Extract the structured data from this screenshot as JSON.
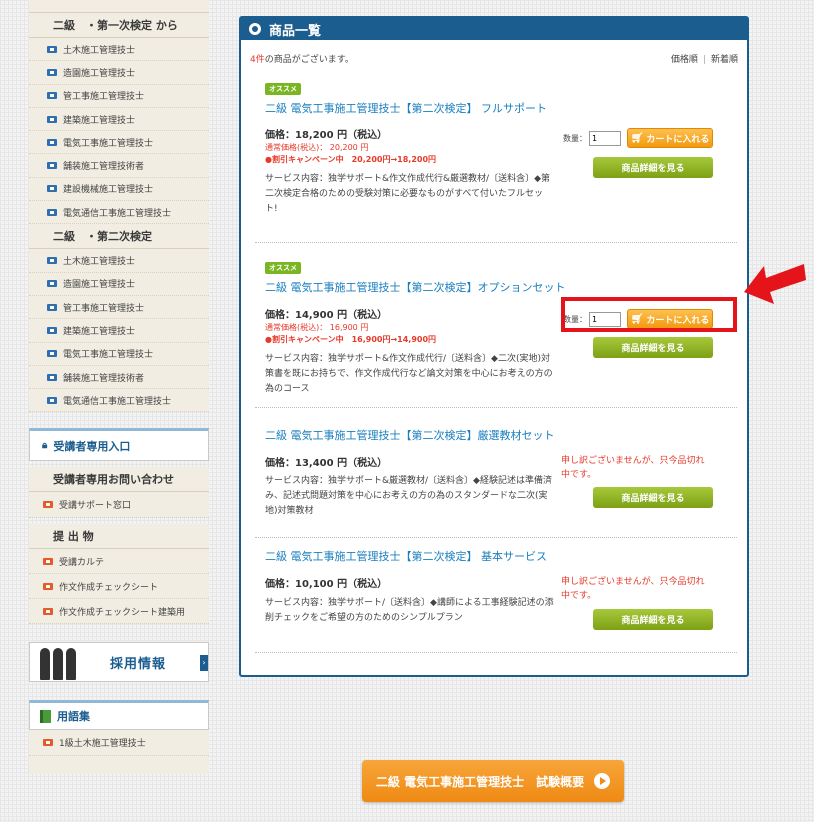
{
  "sidebar": {
    "section1_title": "二級　・第一次検定 から",
    "section1_items": [
      "土木施工管理技士",
      "造園施工管理技士",
      "管工事施工管理技士",
      "建築施工管理技士",
      "電気工事施工管理技士",
      "舗装施工管理技術者",
      "建設機械施工管理技士",
      "電気通信工事施工管理技士"
    ],
    "section2_title": "二級　・第二次検定",
    "section2_items": [
      "土木施工管理技士",
      "造園施工管理技士",
      "管工事施工管理技士",
      "建築施工管理技士",
      "電気工事施工管理技士",
      "舗装施工管理技術者",
      "電気通信工事施工管理技士"
    ],
    "member_entry": "受講者専用入口",
    "contact_title": "受講者専用お問い合わせ",
    "contact_items": [
      "受講サポート窓口"
    ],
    "submission_title": "提 出 物",
    "submission_items": [
      "受講カルテ",
      "作文作成チェックシート",
      "作文作成チェックシート建築用"
    ],
    "recruit": "採用情報",
    "glossary": "用語集",
    "glossary_items": [
      "1級土木施工管理技士"
    ]
  },
  "main": {
    "title": "商品一覧",
    "count_num": "4件",
    "count_text": "の商品がございます。",
    "sort_price": "価格順",
    "sort_new": "新着順",
    "qty_label": "数量：",
    "cart_label": "カートに入れる",
    "detail_label": "商品詳細を見る",
    "products": [
      {
        "badge": "オススメ",
        "title": "二級 電気工事施工管理技士【第二次検定】 フルサポート",
        "price": "価格：18,200 円（税込）",
        "regular": "通常価格(税込)： 20,200 円",
        "campaign": "●割引キャンペーン中　20,200円→18,200円",
        "desc": "サービス内容：独学サポート&作文作成代行&厳選教材/〔送料含〕◆第二次検定合格のための受験対策に必要なものがすべて付いたフルセット!",
        "qty": "1"
      },
      {
        "badge": "オススメ",
        "title": "二級 電気工事施工管理技士【第二次検定】オプションセット",
        "price": "価格：14,900 円（税込）",
        "regular": "通常価格(税込)： 16,900 円",
        "campaign": "●割引キャンペーン中　16,900円→14,900円",
        "desc": "サービス内容：独学サポート&作文作成代行/〔送料含〕◆二次(実地)対策書を既にお持ちで、作文作成代行など論文対策を中心にお考えの方の為のコース",
        "qty": "1"
      },
      {
        "title": "二級 電気工事施工管理技士【第二次検定】厳選教材セット",
        "price": "価格：13,400 円（税込）",
        "desc": "サービス内容：独学サポート&厳選教材/〔送料含〕◆経験記述は準備済み、記述式問題対策を中心にお考えの方の為のスタンダードな二次(実地)対策教材",
        "soldout": "申し訳ございませんが、只今品切れ中です。"
      },
      {
        "title": "二級 電気工事施工管理技士【第二次検定】 基本サービス",
        "price": "価格：10,100 円（税込）",
        "desc": "サービス内容：独学サポート/〔送料含〕◆講師による工事経験記述の添削チェックをご希望の方のためのシンプルプラン",
        "soldout": "申し訳ございませんが、只今品切れ中です。"
      }
    ]
  },
  "bottom_button": "二級 電気工事施工管理技士　試験概要",
  "colors": {
    "accent": "#1c5d8f",
    "highlight": "#e4141a",
    "cart": "#f29a10",
    "detail": "#8fb01f"
  }
}
